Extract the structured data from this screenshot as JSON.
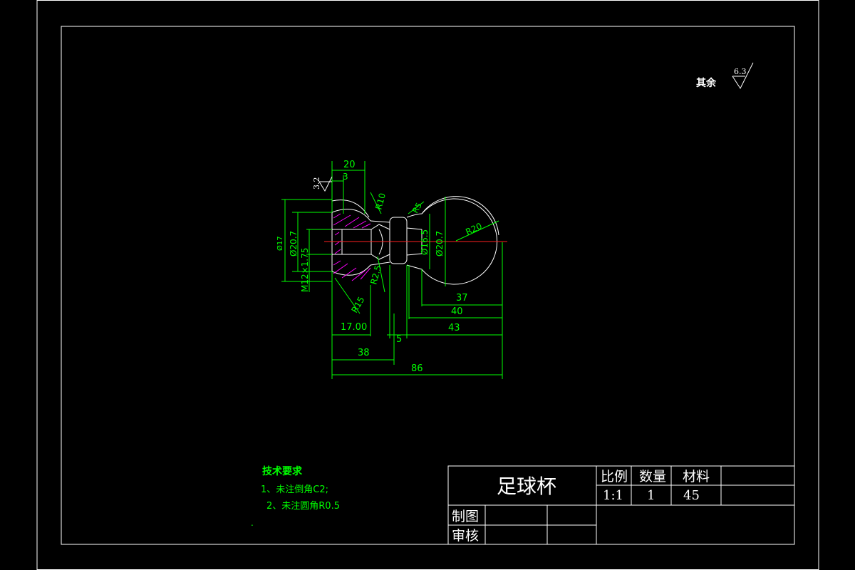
{
  "surface_note": {
    "label": "其余",
    "value": "6.3"
  },
  "roughness_mark": "3.2",
  "dimensions": {
    "d_20": "20",
    "d_3": "3",
    "d_r10": "R10",
    "d_r5": "R5",
    "d_r20": "R20",
    "d_phi165": "Ø16.5",
    "d_phi207_right": "Ø20.7",
    "d_phi207_left": "Ø20.7",
    "d_phi17": "Ø17",
    "d_m12": "M12×1.75",
    "d_r25": "R2.5",
    "d_r15": "R15",
    "d_37": "37",
    "d_40": "40",
    "d_43": "43",
    "d_1700": "17.00",
    "d_5": "5",
    "d_38": "38",
    "d_86": "86"
  },
  "tech_requirements": {
    "title": "技术要求",
    "item1": "1、未注倒角C2;",
    "item2": "2、未注圆角R0.5",
    "dot": "."
  },
  "title_block": {
    "part_name": "足球杯",
    "scale_label": "比例",
    "qty_label": "数量",
    "material_label": "材料",
    "scale_value": "1:1",
    "qty_value": "1",
    "material_value": "45",
    "drawn_label": "制图",
    "checked_label": "审核"
  }
}
